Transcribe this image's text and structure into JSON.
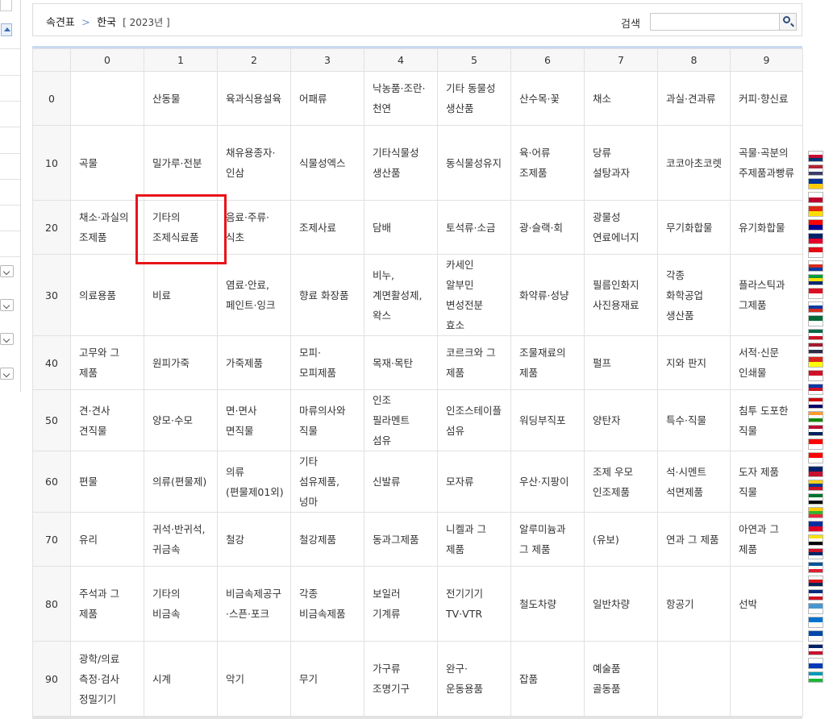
{
  "breadcrumb": {
    "root": "속견표",
    "separator": ">",
    "current": "한국",
    "year": "[ 2023년 ]"
  },
  "search": {
    "label": "검색",
    "placeholder": "",
    "value": ""
  },
  "table": {
    "corner": "",
    "columns": [
      "0",
      "1",
      "2",
      "3",
      "4",
      "5",
      "6",
      "7",
      "8",
      "9"
    ],
    "rows": [
      {
        "label": "0",
        "cells": [
          "",
          "산동물",
          "육과식용설육",
          "어패류",
          "낙농품·조란·천연",
          "기타 동물성 생산품",
          "산수목·꽃",
          "채소",
          "과실·견과류",
          "커피·향신료"
        ]
      },
      {
        "label": "10",
        "cells": [
          "곡물",
          "밀가루·전분",
          "채유용종자·인삼",
          "식물성엑스",
          "기타식물성 생산품",
          "동식물성유지",
          "육·어류 조제품",
          "당류 설탕과자",
          "코코아초코렛",
          "곡물·곡분의 주제품과빵류"
        ]
      },
      {
        "label": "20",
        "cells": [
          "채소·과실의 조제품",
          "기타의 조제식료품",
          "음료·주류·식초",
          "조제사료",
          "담배",
          "토석류·소금",
          "광·슬랙·회",
          "광물성 연료에너지",
          "무기화합물",
          "유기화합물"
        ]
      },
      {
        "label": "30",
        "cells": [
          "의료용품",
          "비료",
          "염료·안료, 페인트·잉크",
          "향료 화장품",
          "비누, 계면활성제, 왁스",
          "카세인 알부민 변성전분 효소",
          "화약류·성냥",
          "필름인화지 사진용재료",
          "각종 화학공업 생산품",
          "플라스틱과 그제품"
        ]
      },
      {
        "label": "40",
        "cells": [
          "고무와 그 제품",
          "원피가죽",
          "가죽제품",
          "모피·모피제품",
          "목재·목탄",
          "코르크와 그 제품",
          "조물재료의 제품",
          "펄프",
          "지와 판지",
          "서적·신문 인쇄물"
        ]
      },
      {
        "label": "50",
        "cells": [
          "견·견사 견직물",
          "양모·수모",
          "면·면사 면직물",
          "마류의사와 직물",
          "인조 필라멘트 섬유",
          "인조스테이플 섬유",
          "워딩부직포",
          "양탄자",
          "특수·직물",
          "침투 도포한 직물"
        ]
      },
      {
        "label": "60",
        "cells": [
          "편물",
          "의류(편물제)",
          "의류(편물제01외)",
          "기타 섬유제품,넝마",
          "신발류",
          "모자류",
          "우산·지팡이",
          "조제 우모 인조제품",
          "석·시멘트 석면제품",
          "도자 제품 직물"
        ]
      },
      {
        "label": "70",
        "cells": [
          "유리",
          "귀석·반귀석,귀금속",
          "철강",
          "철강제품",
          "동과그제품",
          "니켈과 그 제품",
          "알루미늄과 그 제품",
          "(유보)",
          "연과 그 제품",
          "아연과 그 제품"
        ]
      },
      {
        "label": "80",
        "cells": [
          "주석과 그 제품",
          "기타의 비금속",
          "비금속제공구·스픈·포크",
          "각종 비금속제품",
          "보일러 기계류",
          "전기기기 TV·VTR",
          "철도차량",
          "일반차량",
          "항공기",
          "선박"
        ]
      },
      {
        "label": "90",
        "cells": [
          "광학/의료 측정·검사 정밀기기",
          "시계",
          "악기",
          "무기",
          "가구류 조명기구",
          "완구·운동용품",
          "잡품",
          "예술품 골동품",
          "",
          ""
        ]
      }
    ],
    "highlighted_cell": "기타의 조제식료품"
  },
  "flags": [
    {
      "name": "korea-flag-icon",
      "colors": [
        "#ffffff",
        "#c60c30",
        "#003478"
      ]
    },
    {
      "name": "usa-flag-icon",
      "colors": [
        "#b22234",
        "#ffffff",
        "#3c3b6e"
      ]
    },
    {
      "name": "eu-flag-icon",
      "colors": [
        "#003399",
        "#ffcc00"
      ]
    },
    {
      "name": "japan-flag-icon",
      "colors": [
        "#ffffff",
        "#bc002d"
      ]
    },
    {
      "name": "china-flag-icon",
      "colors": [
        "#de2910",
        "#ffde00"
      ]
    },
    {
      "name": "taiwan-flag-icon",
      "colors": [
        "#fe0000",
        "#000095"
      ]
    },
    {
      "name": "australia-flag-icon",
      "colors": [
        "#012169",
        "#e4002b"
      ]
    },
    {
      "name": "turkey-flag-icon",
      "colors": [
        "#e30a17",
        "#ffffff"
      ]
    },
    {
      "name": "chile-flag-icon",
      "colors": [
        "#ffffff",
        "#d52b1e",
        "#0039a6"
      ]
    },
    {
      "name": "brazil-flag-icon",
      "colors": [
        "#009c3b",
        "#ffdf00",
        "#002776"
      ]
    },
    {
      "name": "peru-flag-icon",
      "colors": [
        "#d91023",
        "#ffffff"
      ]
    },
    {
      "name": "russia-flag-icon",
      "colors": [
        "#ffffff",
        "#0039a6",
        "#d52b1e"
      ]
    },
    {
      "name": "saudi-flag-icon",
      "colors": [
        "#006c35",
        "#ffffff"
      ]
    },
    {
      "name": "mexico-flag-icon",
      "colors": [
        "#006847",
        "#ffffff",
        "#ce1126"
      ]
    },
    {
      "name": "thailand-flag-icon",
      "colors": [
        "#a51931",
        "#f4f5f8",
        "#2d2a4a"
      ]
    },
    {
      "name": "vietnam-flag-icon",
      "colors": [
        "#da251d",
        "#ffff00"
      ]
    },
    {
      "name": "indonesia-flag-icon",
      "colors": [
        "#ce1126",
        "#ffffff"
      ]
    },
    {
      "name": "philippines-flag-icon",
      "colors": [
        "#0038a8",
        "#ce1126",
        "#ffffff"
      ]
    },
    {
      "name": "malaysia-flag-icon",
      "colors": [
        "#cc0001",
        "#ffffff",
        "#010066"
      ]
    },
    {
      "name": "india-flag-icon",
      "colors": [
        "#ff9933",
        "#ffffff",
        "#138808"
      ]
    },
    {
      "name": "norway-flag-icon",
      "colors": [
        "#ba0c2f",
        "#ffffff",
        "#00205b"
      ]
    },
    {
      "name": "switzerland-flag-icon",
      "colors": [
        "#ff0000",
        "#ffffff"
      ]
    },
    {
      "name": "canada-flag-icon",
      "colors": [
        "#ff0000",
        "#ffffff"
      ]
    },
    {
      "name": "new-zealand-flag-icon",
      "colors": [
        "#012169",
        "#c8102e"
      ]
    },
    {
      "name": "colombia-flag-icon",
      "colors": [
        "#fcd116",
        "#003893",
        "#ce1126"
      ]
    },
    {
      "name": "uae-flag-icon",
      "colors": [
        "#00732f",
        "#ffffff",
        "#000000",
        "#ff0000"
      ]
    },
    {
      "name": "myanmar-flag-icon",
      "colors": [
        "#fecb00",
        "#34b233",
        "#ea2839"
      ]
    },
    {
      "name": "cambodia-flag-icon",
      "colors": [
        "#032ea1",
        "#e00025"
      ]
    },
    {
      "name": "brunei-flag-icon",
      "colors": [
        "#f7e017",
        "#ffffff",
        "#000000"
      ]
    },
    {
      "name": "laos-flag-icon",
      "colors": [
        "#ce1126",
        "#002868",
        "#ffffff"
      ]
    },
    {
      "name": "iceland-flag-icon",
      "colors": [
        "#02529c",
        "#ffffff",
        "#dc1e35"
      ]
    },
    {
      "name": "panama-flag-icon",
      "colors": [
        "#ffffff",
        "#da121a",
        "#072357"
      ]
    },
    {
      "name": "costa-rica-flag-icon",
      "colors": [
        "#002b7f",
        "#ffffff",
        "#ce1126"
      ]
    },
    {
      "name": "guatemala-flag-icon",
      "colors": [
        "#4997d0",
        "#ffffff"
      ]
    },
    {
      "name": "honduras-flag-icon",
      "colors": [
        "#0073cf",
        "#ffffff"
      ]
    },
    {
      "name": "el-salvador-flag-icon",
      "colors": [
        "#0047ab",
        "#ffffff"
      ]
    },
    {
      "name": "uk-flag-icon",
      "colors": [
        "#012169",
        "#ffffff",
        "#c8102e"
      ]
    },
    {
      "name": "israel-flag-icon",
      "colors": [
        "#ffffff",
        "#0038b8"
      ]
    },
    {
      "name": "uzbekistan-flag-icon",
      "colors": [
        "#0099b5",
        "#ffffff",
        "#1eb53a"
      ]
    }
  ]
}
